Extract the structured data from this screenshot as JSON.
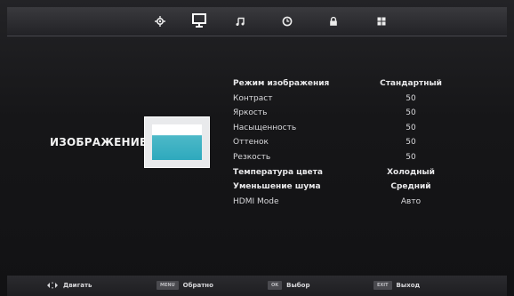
{
  "top_menu": [
    {
      "id": "source",
      "icon": "crosshair-icon",
      "active": false
    },
    {
      "id": "picture",
      "icon": "monitor-icon",
      "active": true
    },
    {
      "id": "sound",
      "icon": "music-note-icon",
      "active": false
    },
    {
      "id": "time",
      "icon": "clock-icon",
      "active": false
    },
    {
      "id": "lock",
      "icon": "lock-icon",
      "active": false
    },
    {
      "id": "setup",
      "icon": "grid-icon",
      "active": false
    }
  ],
  "category": {
    "label": "ИЗОБРАЖЕНИЕ",
    "icon": "picture-glass-icon"
  },
  "settings": [
    {
      "label": "Режим изображения",
      "value": "Стандартный"
    },
    {
      "label": "Контраст",
      "value": "50"
    },
    {
      "label": "Яркость",
      "value": "50"
    },
    {
      "label": "Насыщенность",
      "value": "50"
    },
    {
      "label": "Оттенок",
      "value": "50"
    },
    {
      "label": "Резкость",
      "value": "50"
    },
    {
      "label": "Температура цвета",
      "value": "Холодный"
    },
    {
      "label": "Уменьшение шума",
      "value": "Средний"
    },
    {
      "label": "HDMI Mode",
      "value": "Авто"
    }
  ],
  "hints": {
    "move": {
      "key": "",
      "label": "Двигать"
    },
    "back": {
      "key": "MENU",
      "label": "Обратно"
    },
    "select": {
      "key": "OK",
      "label": "Выбор"
    },
    "exit": {
      "key": "EXIT",
      "label": "Выход"
    }
  },
  "colors": {
    "accent_cyan": "#2ea9bd",
    "background": "#161618",
    "text": "#e8e8ea"
  }
}
